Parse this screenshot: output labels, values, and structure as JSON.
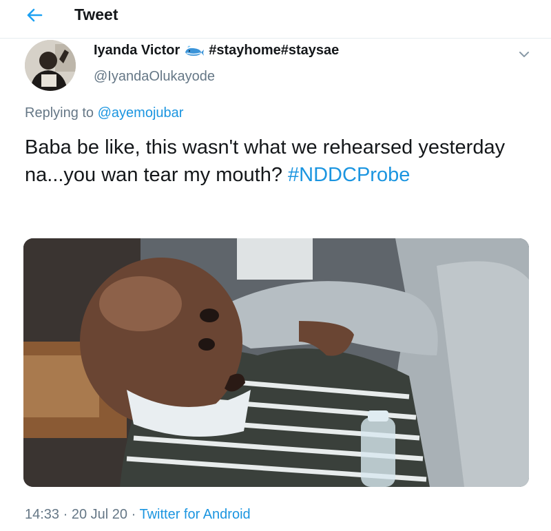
{
  "header": {
    "title": "Tweet"
  },
  "author": {
    "display_name": "Iyanda Victor",
    "name_emoji": "whale-icon",
    "name_suffix": "#stayhome#staysae",
    "handle": "@IyandaOlukayode"
  },
  "reply": {
    "prefix": "Replying to",
    "mention": "@ayemojubar"
  },
  "tweet": {
    "text": "Baba be like, this wasn't what we rehearsed yesterday na...you wan tear my mouth?",
    "hashtag": "#NDDCProbe"
  },
  "meta": {
    "time": "14:33",
    "separator": "·",
    "date": "20 Jul 20",
    "source": "Twitter for Android"
  },
  "colors": {
    "link": "#1b95e0",
    "secondary_text": "#657786",
    "primary_text": "#14171a"
  }
}
